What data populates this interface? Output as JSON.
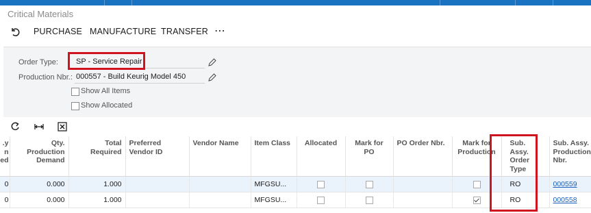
{
  "page": {
    "title": "Critical Materials"
  },
  "toolbar": {
    "undo_icon": "undo-icon",
    "purchase_label": "PURCHASE",
    "manufacture_label": "MANUFACTURE",
    "transfer_label": "TRANSFER",
    "more_label": "⋯"
  },
  "form": {
    "order_type_label": "Order Type:",
    "order_type_value": "SP - Service Repair",
    "production_nbr_label": "Production Nbr.:",
    "production_nbr_value": "000557 - Build Keurig Model 450",
    "show_all_items_label": "Show All Items",
    "show_allocated_label": "Show Allocated"
  },
  "grid": {
    "columns": [
      "Qty. on ed",
      "Qty. Production Demand",
      "Total Required",
      "Preferred Vendor ID",
      "Vendor Name",
      "Item Class",
      "Allocated",
      "Mark for PO",
      "PO Order Nbr.",
      "Mark for Production",
      "Sub. Assy. Order Type",
      "Sub. Assy. Production Nbr."
    ],
    "rows": [
      {
        "qty_cut": "0",
        "qty_production_demand": "0.000",
        "total_required": "1.000",
        "preferred_vendor_id": "",
        "vendor_name": "",
        "item_class": "MFGSU...",
        "allocated": false,
        "mark_for_po": false,
        "po_order_nbr": "",
        "mark_for_production": false,
        "sub_assy_order_type": "RO",
        "sub_assy_production_nbr": "000559"
      },
      {
        "qty_cut": "0",
        "qty_production_demand": "0.000",
        "total_required": "1.000",
        "preferred_vendor_id": "",
        "vendor_name": "",
        "item_class": "MFGSU...",
        "allocated": false,
        "mark_for_po": false,
        "po_order_nbr": "",
        "mark_for_production": true,
        "sub_assy_order_type": "RO",
        "sub_assy_production_nbr": "000558"
      }
    ]
  },
  "colors": {
    "topbar": "#1a73c1",
    "highlight": "#d1121f",
    "link": "#1d5fb8"
  }
}
